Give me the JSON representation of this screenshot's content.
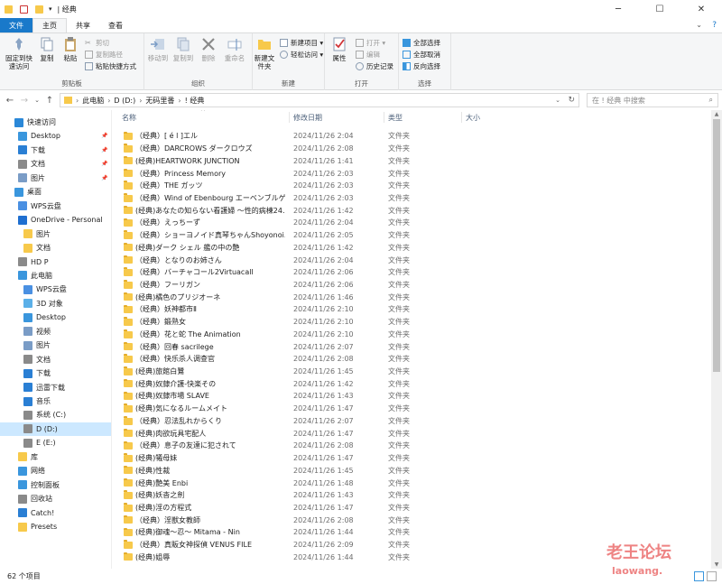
{
  "window": {
    "title": "| 经典"
  },
  "tabs": {
    "file": "文件",
    "home": "主页",
    "share": "共享",
    "view": "查看"
  },
  "ribbon": {
    "clipboard": {
      "label": "剪贴板",
      "pin": "固定到快速访问",
      "copy": "复制",
      "paste": "粘贴",
      "cut": "剪切",
      "copy_path": "复制路径",
      "paste_shortcut": "粘贴快捷方式"
    },
    "organize": {
      "label": "组织",
      "move_to": "移动到",
      "copy_to": "复制到",
      "delete": "删除",
      "rename": "重命名"
    },
    "new": {
      "label": "新建",
      "new_folder": "新建文件夹",
      "new_item": "新建项目 ▾",
      "easy_access": "轻松访问 ▾"
    },
    "open": {
      "label": "打开",
      "properties": "属性",
      "open": "打开 ▾",
      "edit": "编辑",
      "history": "历史记录"
    },
    "select": {
      "label": "选择",
      "select_all": "全部选择",
      "select_none": "全部取消",
      "invert": "反向选择"
    }
  },
  "address": {
    "crumbs": [
      "此电脑",
      "D (D:)",
      "无码里番",
      "! 经典"
    ],
    "search_placeholder": "在 ! 经典 中搜索"
  },
  "columns": {
    "name": "名称",
    "date": "修改日期",
    "type": "类型",
    "size": "大小"
  },
  "nav": {
    "items": [
      {
        "label": "快速访问",
        "icon_color": "#2b88d8",
        "indent": 0
      },
      {
        "label": "Desktop",
        "icon_color": "#3a96dd",
        "indent": 1,
        "pin": true
      },
      {
        "label": "下载",
        "icon_color": "#2a7fd4",
        "indent": 1,
        "pin": true
      },
      {
        "label": "文档",
        "icon_color": "#8a8a8a",
        "indent": 1,
        "pin": true
      },
      {
        "label": "图片",
        "icon_color": "#7a9cc6",
        "indent": 1,
        "pin": true
      },
      {
        "label": "桌面",
        "icon_color": "#3a96dd",
        "indent": 0
      },
      {
        "label": "WPS云盘",
        "icon_color": "#4a90e2",
        "indent": 1
      },
      {
        "label": "OneDrive - Personal",
        "icon_color": "#1f6fd0",
        "indent": 1
      },
      {
        "label": "图片",
        "icon_color": "#f7c94b",
        "indent": 2
      },
      {
        "label": "文档",
        "icon_color": "#f7c94b",
        "indent": 2
      },
      {
        "label": "HD P",
        "icon_color": "#8a8a8a",
        "indent": 1
      },
      {
        "label": "此电脑",
        "icon_color": "#3a96dd",
        "indent": 1
      },
      {
        "label": "WPS云盘",
        "icon_color": "#4a90e2",
        "indent": 2
      },
      {
        "label": "3D 对象",
        "icon_color": "#5bb0e8",
        "indent": 2
      },
      {
        "label": "Desktop",
        "icon_color": "#3a96dd",
        "indent": 2
      },
      {
        "label": "视频",
        "icon_color": "#7a9cc6",
        "indent": 2
      },
      {
        "label": "图片",
        "icon_color": "#7a9cc6",
        "indent": 2
      },
      {
        "label": "文档",
        "icon_color": "#8a8a8a",
        "indent": 2
      },
      {
        "label": "下载",
        "icon_color": "#2a7fd4",
        "indent": 2
      },
      {
        "label": "迅雷下载",
        "icon_color": "#2a7fd4",
        "indent": 2
      },
      {
        "label": "音乐",
        "icon_color": "#2a7fd4",
        "indent": 2
      },
      {
        "label": "系统 (C:)",
        "icon_color": "#8a8a8a",
        "indent": 2
      },
      {
        "label": "D (D:)",
        "icon_color": "#8a8a8a",
        "indent": 2,
        "selected": true
      },
      {
        "label": "E (E:)",
        "icon_color": "#8a8a8a",
        "indent": 2
      },
      {
        "label": "库",
        "icon_color": "#f7c94b",
        "indent": 1
      },
      {
        "label": "网络",
        "icon_color": "#3a96dd",
        "indent": 1
      },
      {
        "label": "控制面板",
        "icon_color": "#3a96dd",
        "indent": 1
      },
      {
        "label": "回收站",
        "icon_color": "#8a8a8a",
        "indent": 1
      },
      {
        "label": "Catch!",
        "icon_color": "#2a7fd4",
        "indent": 1
      },
      {
        "label": "Presets",
        "icon_color": "#f7c94b",
        "indent": 1
      }
    ]
  },
  "files": [
    {
      "name": "（经典）[ é l ]エル",
      "date": "2024/11/26 2:04",
      "type": "文件夹"
    },
    {
      "name": "（经典）DARCROWS ダークロウズ",
      "date": "2024/11/26 2:08",
      "type": "文件夹"
    },
    {
      "name": "(经典)HEARTWORK JUNCTION",
      "date": "2024/11/26 1:41",
      "type": "文件夹"
    },
    {
      "name": "（经典）Princess Memory",
      "date": "2024/11/26 2:03",
      "type": "文件夹"
    },
    {
      "name": "（经典）THE ガッツ",
      "date": "2024/11/26 2:03",
      "type": "文件夹"
    },
    {
      "name": "（经典）Wind of Ebenbourg エーベンブルゲ...",
      "date": "2024/11/26 2:03",
      "type": "文件夹"
    },
    {
      "name": "(经典)あなたの知らない看護婦 ～性的病棟24...",
      "date": "2024/11/26 1:42",
      "type": "文件夹"
    },
    {
      "name": "（经典）えっちーず",
      "date": "2024/11/26 2:04",
      "type": "文件夹"
    },
    {
      "name": "（经典）ショーヨノイド真琴ちゃんShoyonoi...",
      "date": "2024/11/26 2:05",
      "type": "文件夹"
    },
    {
      "name": "(经典)ダーク シェル 艦の中の艶",
      "date": "2024/11/26 1:42",
      "type": "文件夹"
    },
    {
      "name": "（经典）となりのお姉さん",
      "date": "2024/11/26 2:04",
      "type": "文件夹"
    },
    {
      "name": "（经典）バーチャコール2Virtuacall",
      "date": "2024/11/26 2:06",
      "type": "文件夹"
    },
    {
      "name": "（经典）フーリガン",
      "date": "2024/11/26 2:06",
      "type": "文件夹"
    },
    {
      "name": "(经典)橘色のプリジオーネ",
      "date": "2024/11/26 1:46",
      "type": "文件夹"
    },
    {
      "name": "（经典）妖神都市Ⅱ",
      "date": "2024/11/26 2:10",
      "type": "文件夹"
    },
    {
      "name": "（经典）鍛熟女",
      "date": "2024/11/26 2:10",
      "type": "文件夹"
    },
    {
      "name": "（经典）花と蛇 The Animation",
      "date": "2024/11/26 2:10",
      "type": "文件夹"
    },
    {
      "name": "（经典）回春 sacrilege",
      "date": "2024/11/26 2:07",
      "type": "文件夹"
    },
    {
      "name": "（经典）快乐杀人调查官",
      "date": "2024/11/26 2:08",
      "type": "文件夹"
    },
    {
      "name": "(经典)旅館白鷺",
      "date": "2024/11/26 1:45",
      "type": "文件夹"
    },
    {
      "name": "(经典)奴隷介護-快楽その",
      "date": "2024/11/26 1:42",
      "type": "文件夹"
    },
    {
      "name": "(经典)奴隷市場 SLAVE",
      "date": "2024/11/26 1:43",
      "type": "文件夹"
    },
    {
      "name": "(经典)気になるルームメイト",
      "date": "2024/11/26 1:47",
      "type": "文件夹"
    },
    {
      "name": "（经典）忍法乱れからくり",
      "date": "2024/11/26 2:07",
      "type": "文件夹"
    },
    {
      "name": "(经典)肉欲玩具宅配人",
      "date": "2024/11/26 1:47",
      "type": "文件夹"
    },
    {
      "name": "（经典）息子の友達に犯されて",
      "date": "2024/11/26 2:08",
      "type": "文件夹"
    },
    {
      "name": "(经典)犧母妹",
      "date": "2024/11/26 1:47",
      "type": "文件夹"
    },
    {
      "name": "(经典)性裁",
      "date": "2024/11/26 1:45",
      "type": "文件夹"
    },
    {
      "name": "(经典)艶美 Enbi",
      "date": "2024/11/26 1:48",
      "type": "文件夹"
    },
    {
      "name": "(经典)妖杳之劍",
      "date": "2024/11/26 1:43",
      "type": "文件夹"
    },
    {
      "name": "(经典)淫の方程式",
      "date": "2024/11/26 1:47",
      "type": "文件夹"
    },
    {
      "name": "（经典）淫獣女教師",
      "date": "2024/11/26 2:08",
      "type": "文件夹"
    },
    {
      "name": "(经典)御魂～忍～ Mitama - Nin",
      "date": "2024/11/26 1:44",
      "type": "文件夹"
    },
    {
      "name": "（经典）真販女神探偵 VENUS FILE",
      "date": "2024/11/26 2:09",
      "type": "文件夹"
    },
    {
      "name": "(经典)姐辱",
      "date": "2024/11/26 1:44",
      "type": "文件夹"
    }
  ],
  "status": {
    "count": "62 个项目"
  },
  "watermark": {
    "title": "老王论坛",
    "site": "laowang."
  }
}
